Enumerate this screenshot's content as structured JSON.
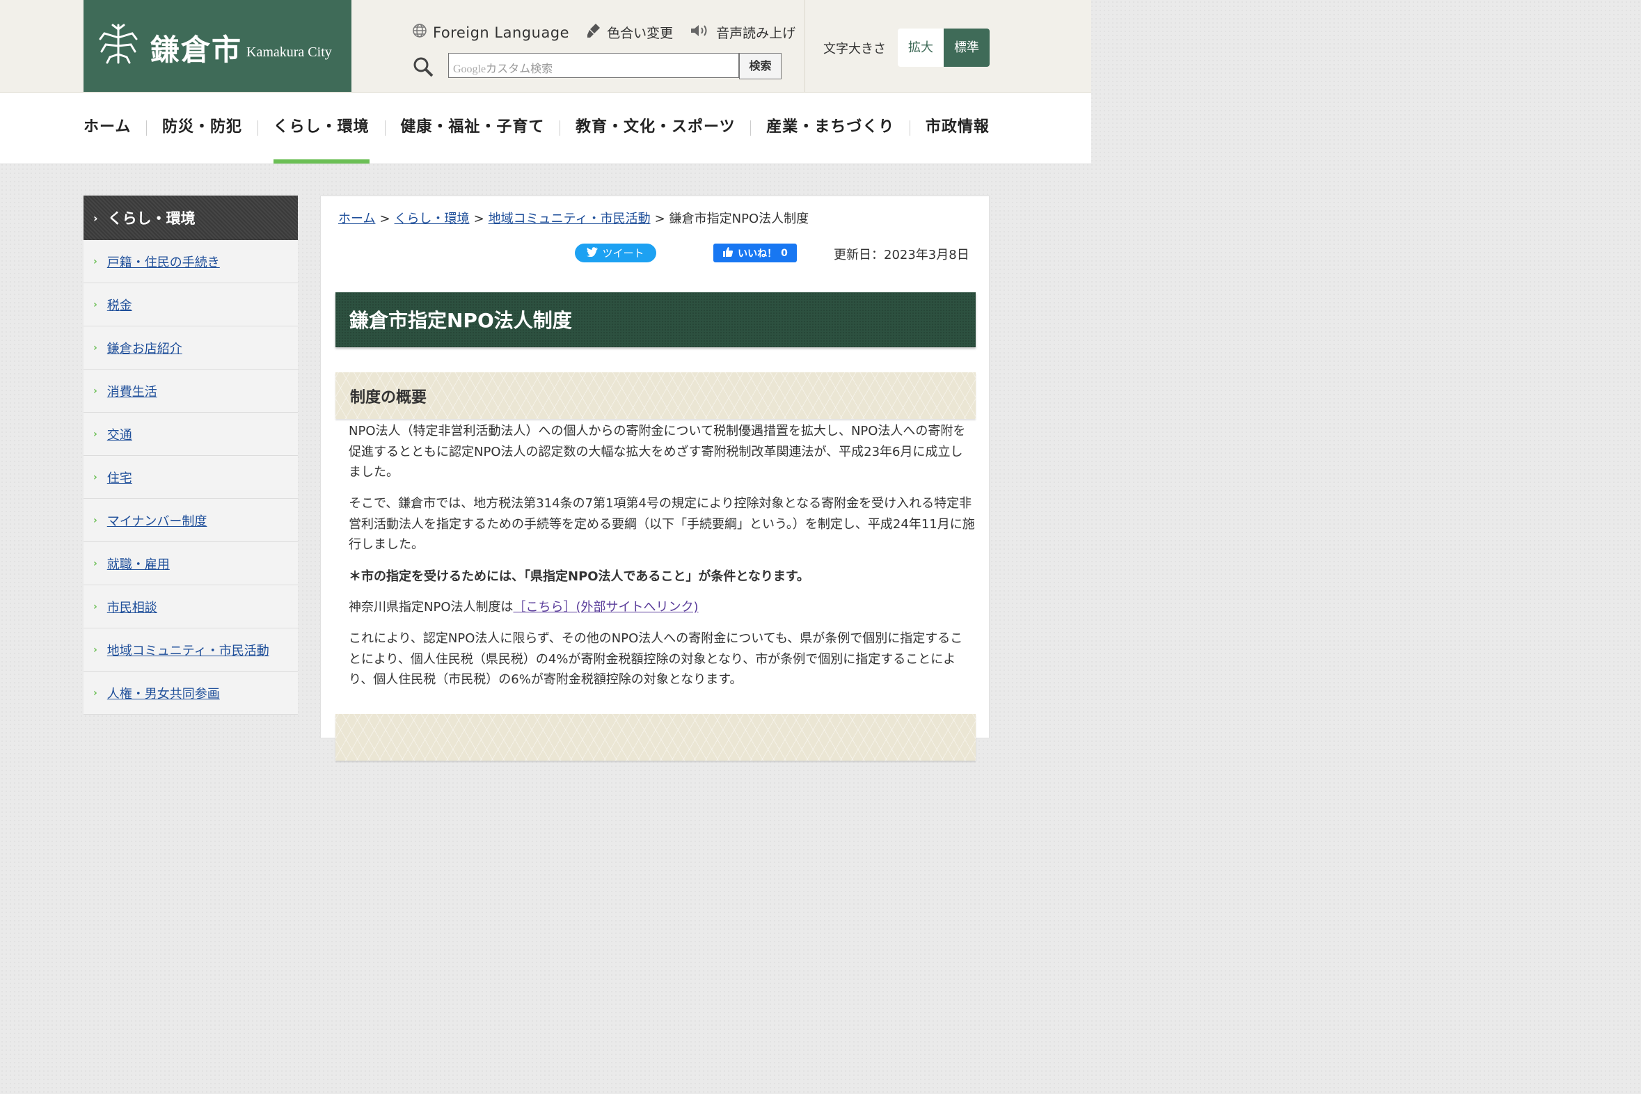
{
  "header": {
    "city_name_jp": "鎌倉市",
    "city_name_en": "Kamakura City",
    "foreign_language": "Foreign Language",
    "color_change": "色合い変更",
    "read_aloud": "音声読み上げ",
    "search_placeholder_brand": "Google",
    "search_placeholder_text": "カスタム検索",
    "search_button": "検索",
    "font_size_label": "文字大きさ",
    "font_size_large": "拡大",
    "font_size_standard": "標準"
  },
  "colors": {
    "brand_green": "#3f6b58",
    "nav_active": "#6bbf55",
    "title_band": "#2d5140",
    "subheading_band": "#ebe6d4",
    "link": "#1f4f9a"
  },
  "gnav": {
    "items": [
      {
        "label": "ホーム"
      },
      {
        "label": "防災・防犯"
      },
      {
        "label": "くらし・環境",
        "active": true
      },
      {
        "label": "健康・福祉・子育て"
      },
      {
        "label": "教育・文化・スポーツ"
      },
      {
        "label": "産業・まちづくり"
      },
      {
        "label": "市政情報"
      }
    ]
  },
  "sidebar": {
    "heading": "くらし・環境",
    "items": [
      {
        "label": "戸籍・住民の手続き"
      },
      {
        "label": "税金"
      },
      {
        "label": "鎌倉お店紹介"
      },
      {
        "label": "消費生活"
      },
      {
        "label": "交通"
      },
      {
        "label": "住宅"
      },
      {
        "label": "マイナンバー制度"
      },
      {
        "label": "就職・雇用"
      },
      {
        "label": "市民相談"
      },
      {
        "label": "地域コミュニティ・市民活動"
      },
      {
        "label": "人権・男女共同参画"
      }
    ]
  },
  "breadcrumb": {
    "home": "ホーム",
    "level1": "くらし・環境",
    "level2": "地域コミュニティ・市民活動",
    "current": "鎌倉市指定NPO法人制度"
  },
  "social": {
    "tweet": "ツイート",
    "like": "いいね！",
    "like_count": "0"
  },
  "page": {
    "updated": "更新日：2023年3月8日",
    "title": "鎌倉市指定NPO法人制度",
    "section_title": "制度の概要",
    "p1": "NPO法人（特定非営利活動法人）への個人からの寄附金について税制優遇措置を拡大し、NPO法人への寄附を促進するとともに認定NPO法人の認定数の大幅な拡大をめざす寄附税制改革関連法が、平成23年6月に成立しました。",
    "p2": "そこで、鎌倉市では、地方税法第314条の7第1項第4号の規定により控除対象となる寄附金を受け入れる特定非営利活動法人を指定するための手続等を定める要綱（以下「手続要綱」という。）を制定し、平成24年11月に施行しました。",
    "p3": "＊市の指定を受けるためには、「県指定NPO法人であること」が条件となります。",
    "p4_prefix": "神奈川県指定NPO法人制度は",
    "p4_link": "［こちら］(外部サイトへリンク)",
    "p5": "これにより、認定NPO法人に限らず、その他のNPO法人への寄附金についても、県が条例で個別に指定することにより、個人住民税（県民税）の4%が寄附金税額控除の対象となり、市が条例で個別に指定することにより、個人住民税（市民税）の6%が寄附金税額控除の対象となります。"
  }
}
